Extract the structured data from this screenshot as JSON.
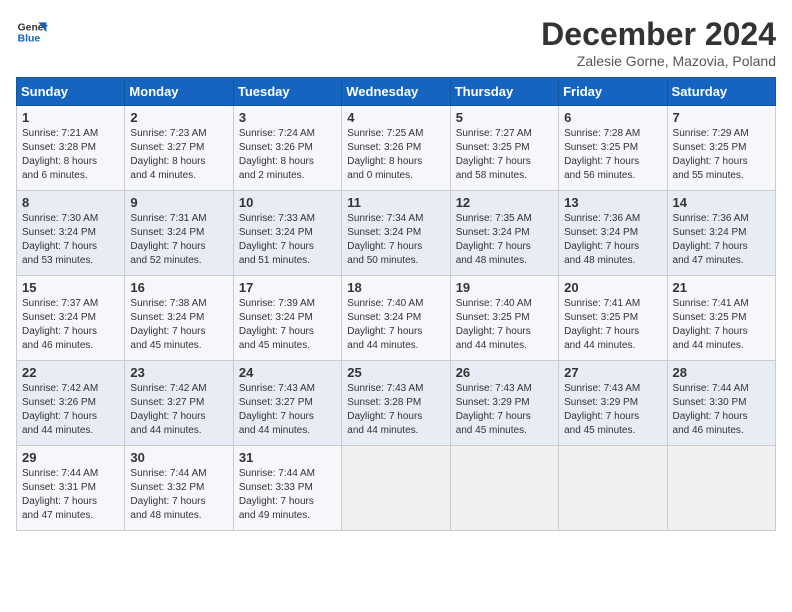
{
  "logo": {
    "line1": "General",
    "line2": "Blue"
  },
  "title": "December 2024",
  "subtitle": "Zalesie Gorne, Mazovia, Poland",
  "days_header": [
    "Sunday",
    "Monday",
    "Tuesday",
    "Wednesday",
    "Thursday",
    "Friday",
    "Saturday"
  ],
  "weeks": [
    [
      {
        "day": "1",
        "info": "Sunrise: 7:21 AM\nSunset: 3:28 PM\nDaylight: 8 hours\nand 6 minutes."
      },
      {
        "day": "2",
        "info": "Sunrise: 7:23 AM\nSunset: 3:27 PM\nDaylight: 8 hours\nand 4 minutes."
      },
      {
        "day": "3",
        "info": "Sunrise: 7:24 AM\nSunset: 3:26 PM\nDaylight: 8 hours\nand 2 minutes."
      },
      {
        "day": "4",
        "info": "Sunrise: 7:25 AM\nSunset: 3:26 PM\nDaylight: 8 hours\nand 0 minutes."
      },
      {
        "day": "5",
        "info": "Sunrise: 7:27 AM\nSunset: 3:25 PM\nDaylight: 7 hours\nand 58 minutes."
      },
      {
        "day": "6",
        "info": "Sunrise: 7:28 AM\nSunset: 3:25 PM\nDaylight: 7 hours\nand 56 minutes."
      },
      {
        "day": "7",
        "info": "Sunrise: 7:29 AM\nSunset: 3:25 PM\nDaylight: 7 hours\nand 55 minutes."
      }
    ],
    [
      {
        "day": "8",
        "info": "Sunrise: 7:30 AM\nSunset: 3:24 PM\nDaylight: 7 hours\nand 53 minutes."
      },
      {
        "day": "9",
        "info": "Sunrise: 7:31 AM\nSunset: 3:24 PM\nDaylight: 7 hours\nand 52 minutes."
      },
      {
        "day": "10",
        "info": "Sunrise: 7:33 AM\nSunset: 3:24 PM\nDaylight: 7 hours\nand 51 minutes."
      },
      {
        "day": "11",
        "info": "Sunrise: 7:34 AM\nSunset: 3:24 PM\nDaylight: 7 hours\nand 50 minutes."
      },
      {
        "day": "12",
        "info": "Sunrise: 7:35 AM\nSunset: 3:24 PM\nDaylight: 7 hours\nand 48 minutes."
      },
      {
        "day": "13",
        "info": "Sunrise: 7:36 AM\nSunset: 3:24 PM\nDaylight: 7 hours\nand 48 minutes."
      },
      {
        "day": "14",
        "info": "Sunrise: 7:36 AM\nSunset: 3:24 PM\nDaylight: 7 hours\nand 47 minutes."
      }
    ],
    [
      {
        "day": "15",
        "info": "Sunrise: 7:37 AM\nSunset: 3:24 PM\nDaylight: 7 hours\nand 46 minutes."
      },
      {
        "day": "16",
        "info": "Sunrise: 7:38 AM\nSunset: 3:24 PM\nDaylight: 7 hours\nand 45 minutes."
      },
      {
        "day": "17",
        "info": "Sunrise: 7:39 AM\nSunset: 3:24 PM\nDaylight: 7 hours\nand 45 minutes."
      },
      {
        "day": "18",
        "info": "Sunrise: 7:40 AM\nSunset: 3:24 PM\nDaylight: 7 hours\nand 44 minutes."
      },
      {
        "day": "19",
        "info": "Sunrise: 7:40 AM\nSunset: 3:25 PM\nDaylight: 7 hours\nand 44 minutes."
      },
      {
        "day": "20",
        "info": "Sunrise: 7:41 AM\nSunset: 3:25 PM\nDaylight: 7 hours\nand 44 minutes."
      },
      {
        "day": "21",
        "info": "Sunrise: 7:41 AM\nSunset: 3:25 PM\nDaylight: 7 hours\nand 44 minutes."
      }
    ],
    [
      {
        "day": "22",
        "info": "Sunrise: 7:42 AM\nSunset: 3:26 PM\nDaylight: 7 hours\nand 44 minutes."
      },
      {
        "day": "23",
        "info": "Sunrise: 7:42 AM\nSunset: 3:27 PM\nDaylight: 7 hours\nand 44 minutes."
      },
      {
        "day": "24",
        "info": "Sunrise: 7:43 AM\nSunset: 3:27 PM\nDaylight: 7 hours\nand 44 minutes."
      },
      {
        "day": "25",
        "info": "Sunrise: 7:43 AM\nSunset: 3:28 PM\nDaylight: 7 hours\nand 44 minutes."
      },
      {
        "day": "26",
        "info": "Sunrise: 7:43 AM\nSunset: 3:29 PM\nDaylight: 7 hours\nand 45 minutes."
      },
      {
        "day": "27",
        "info": "Sunrise: 7:43 AM\nSunset: 3:29 PM\nDaylight: 7 hours\nand 45 minutes."
      },
      {
        "day": "28",
        "info": "Sunrise: 7:44 AM\nSunset: 3:30 PM\nDaylight: 7 hours\nand 46 minutes."
      }
    ],
    [
      {
        "day": "29",
        "info": "Sunrise: 7:44 AM\nSunset: 3:31 PM\nDaylight: 7 hours\nand 47 minutes."
      },
      {
        "day": "30",
        "info": "Sunrise: 7:44 AM\nSunset: 3:32 PM\nDaylight: 7 hours\nand 48 minutes."
      },
      {
        "day": "31",
        "info": "Sunrise: 7:44 AM\nSunset: 3:33 PM\nDaylight: 7 hours\nand 49 minutes."
      },
      {
        "day": "",
        "info": ""
      },
      {
        "day": "",
        "info": ""
      },
      {
        "day": "",
        "info": ""
      },
      {
        "day": "",
        "info": ""
      }
    ]
  ]
}
